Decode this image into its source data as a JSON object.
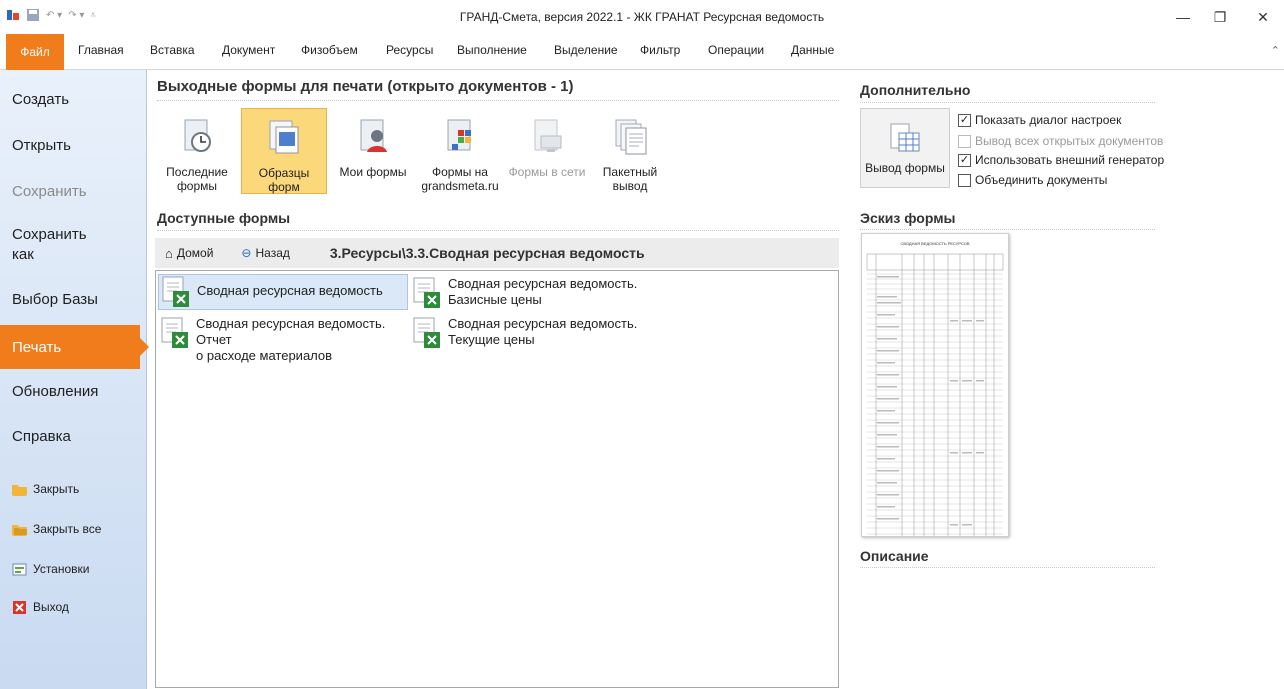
{
  "window": {
    "title": "ГРАНД-Смета, версия 2022.1 - ЖК ГРАНАТ Ресурсная ведомость"
  },
  "ribbon": {
    "file_tab": "Файл",
    "tabs": [
      "Главная",
      "Вставка",
      "Документ",
      "Физобъем",
      "Ресурсы",
      "Выполнение",
      "Выделение",
      "Фильтр",
      "Операции",
      "Данные"
    ]
  },
  "nav": {
    "create": "Создать",
    "open": "Открыть",
    "save": "Сохранить",
    "save_as": "Сохранить как",
    "select_base": "Выбор Базы",
    "print": "Печать",
    "updates": "Обновления",
    "help": "Справка",
    "close": "Закрыть",
    "close_all": "Закрыть все",
    "settings": "Установки",
    "exit": "Выход"
  },
  "main": {
    "title": "Выходные формы для печати (открыто документов - 1)",
    "buttons": [
      {
        "line1": "Последние",
        "line2": "формы"
      },
      {
        "line1": "Образцы",
        "line2": "форм"
      },
      {
        "line1": "Мои формы",
        "line2": ""
      },
      {
        "line1": "Формы на",
        "line2": "grandsmeta.ru"
      },
      {
        "line1": "Формы в сети",
        "line2": ""
      },
      {
        "line1": "Пакетный",
        "line2": "вывод"
      }
    ],
    "available_title": "Доступные формы",
    "home": "Домой",
    "back": "Назад",
    "path": "3.Ресурсы\\3.3.Сводная ресурсная ведомость",
    "forms": [
      {
        "line1": "Сводная ресурсная ведомость",
        "line2": ""
      },
      {
        "line1": "Сводная ресурсная ведомость.",
        "line2": "Базисные цены"
      },
      {
        "line1": "Сводная ресурсная ведомость. Отчет",
        "line2": "о расходе материалов"
      },
      {
        "line1": "Сводная ресурсная ведомость.",
        "line2": "Текущие цены"
      }
    ]
  },
  "right": {
    "additional_title": "Дополнительно",
    "output_button": "Вывод формы",
    "checks": [
      {
        "label": "Показать диалог настроек",
        "checked": true,
        "disabled": false
      },
      {
        "label": "Вывод всех открытых документов",
        "checked": false,
        "disabled": true
      },
      {
        "label": "Использовать внешний генератор",
        "checked": true,
        "disabled": false
      },
      {
        "label": "Объединить документы",
        "checked": false,
        "disabled": false
      }
    ],
    "sketch_title": "Эскиз формы",
    "description_title": "Описание",
    "preview_heading": "СВОДНАЯ ВЕДОМОСТЬ РЕСУРСОВ"
  },
  "colors": {
    "accent": "#f07c1c",
    "selected": "#fbd87a"
  }
}
